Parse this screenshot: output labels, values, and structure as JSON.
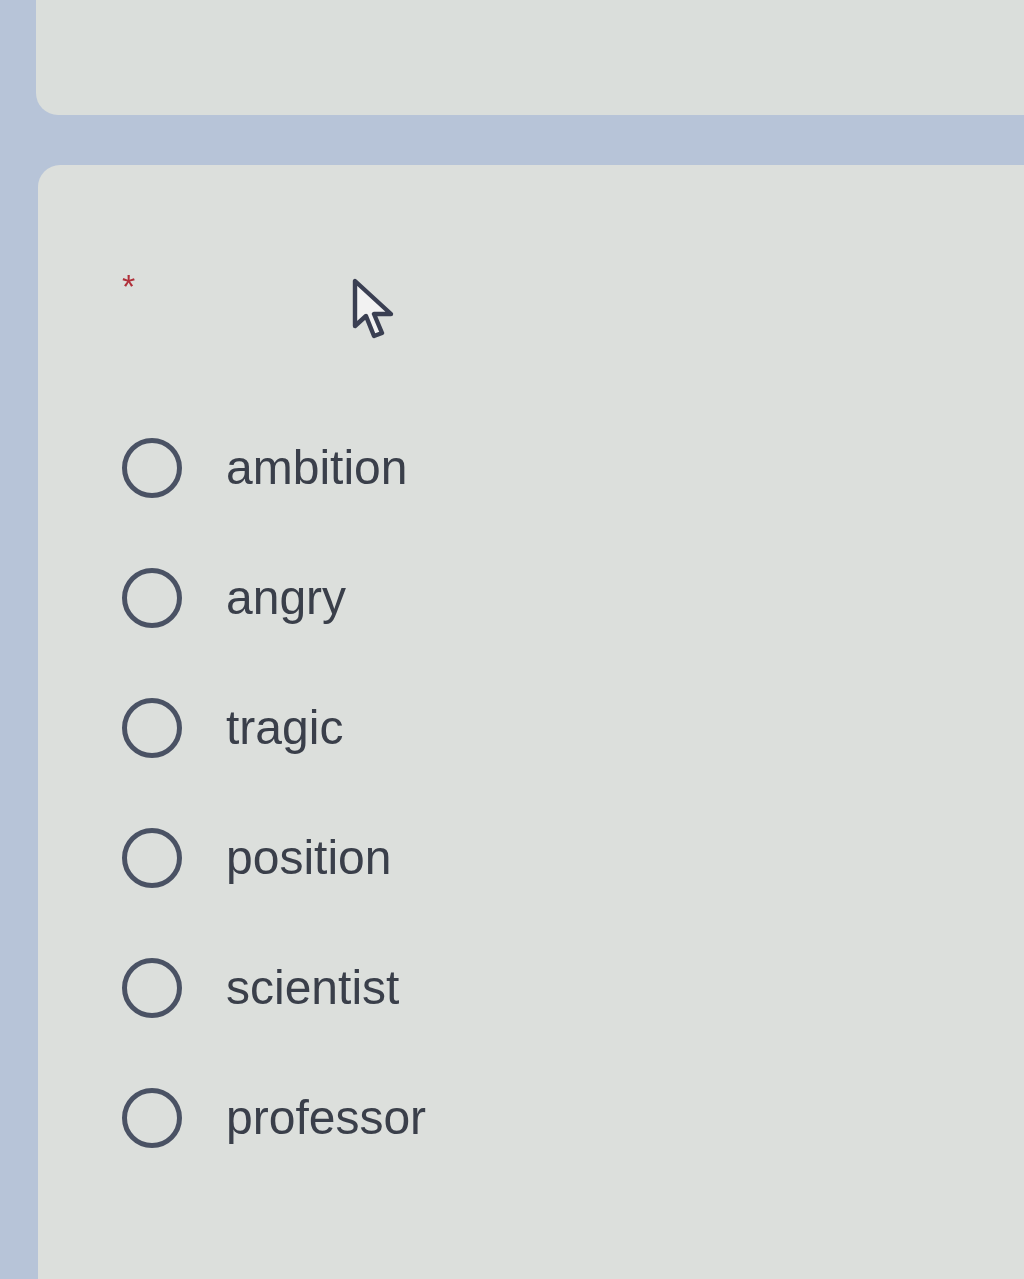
{
  "question": {
    "required_mark": "*"
  },
  "options": [
    {
      "label": "ambition",
      "selected": false
    },
    {
      "label": "angry",
      "selected": false
    },
    {
      "label": "tragic",
      "selected": false
    },
    {
      "label": "position",
      "selected": false
    },
    {
      "label": "scientist",
      "selected": false
    },
    {
      "label": "professor",
      "selected": false
    }
  ]
}
